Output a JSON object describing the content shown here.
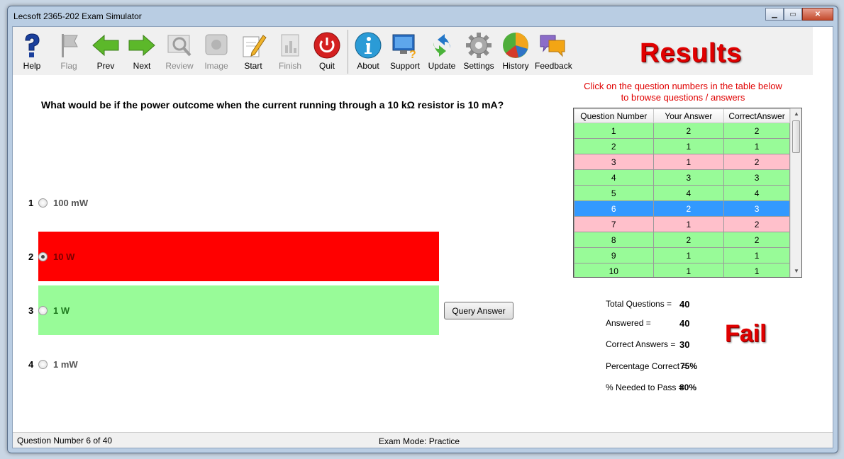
{
  "window": {
    "title": "Lecsoft 2365-202 Exam Simulator",
    "minimize_glyph": "▁",
    "maximize_glyph": "▭",
    "close_glyph": "✕"
  },
  "toolbar": {
    "items": [
      {
        "label": "Help",
        "icon": "help-icon",
        "enabled": true
      },
      {
        "label": "Flag",
        "icon": "flag-icon",
        "enabled": false
      },
      {
        "label": "Prev",
        "icon": "arrow-left-icon",
        "enabled": true
      },
      {
        "label": "Next",
        "icon": "arrow-right-icon",
        "enabled": true
      },
      {
        "label": "Review",
        "icon": "magnifier-icon",
        "enabled": false
      },
      {
        "label": "Image",
        "icon": "image-icon",
        "enabled": false
      },
      {
        "label": "Start",
        "icon": "pencil-paper-icon",
        "enabled": true
      },
      {
        "label": "Finish",
        "icon": "report-icon",
        "enabled": false
      },
      {
        "label": "Quit",
        "icon": "power-icon",
        "enabled": true
      },
      {
        "label": "About",
        "icon": "info-icon",
        "enabled": true
      },
      {
        "label": "Support",
        "icon": "support-monitor-icon",
        "enabled": true
      },
      {
        "label": "Update",
        "icon": "update-arrows-icon",
        "enabled": true
      },
      {
        "label": "Settings",
        "icon": "gear-icon",
        "enabled": true
      },
      {
        "label": "History",
        "icon": "pie-chart-icon",
        "enabled": true
      },
      {
        "label": "Feedback",
        "icon": "speech-bubbles-icon",
        "enabled": true
      }
    ]
  },
  "results": {
    "title": "Results",
    "hint_line1": "Click on the question numbers in the table below",
    "hint_line2": "to browse questions / answers",
    "columns": [
      "Question Number",
      "Your Answer",
      "CorrectAnswer"
    ],
    "rows": [
      {
        "q": "1",
        "yours": "2",
        "correct": "2",
        "status": "ok"
      },
      {
        "q": "2",
        "yours": "1",
        "correct": "1",
        "status": "ok"
      },
      {
        "q": "3",
        "yours": "1",
        "correct": "2",
        "status": "bad"
      },
      {
        "q": "4",
        "yours": "3",
        "correct": "3",
        "status": "ok"
      },
      {
        "q": "5",
        "yours": "4",
        "correct": "4",
        "status": "ok"
      },
      {
        "q": "6",
        "yours": "2",
        "correct": "3",
        "status": "sel"
      },
      {
        "q": "7",
        "yours": "1",
        "correct": "2",
        "status": "bad"
      },
      {
        "q": "8",
        "yours": "2",
        "correct": "2",
        "status": "ok"
      },
      {
        "q": "9",
        "yours": "1",
        "correct": "1",
        "status": "ok"
      },
      {
        "q": "10",
        "yours": "1",
        "correct": "1",
        "status": "ok"
      }
    ]
  },
  "question": {
    "text": "What would be if the power outcome when the current running through a 10 kΩ resistor is 10 mA?",
    "options": [
      {
        "num": "1",
        "text": "100 mW",
        "checked": false
      },
      {
        "num": "2",
        "text": "10 W",
        "checked": true
      },
      {
        "num": "3",
        "text": "1 W",
        "checked": false
      },
      {
        "num": "4",
        "text": "1 mW",
        "checked": false
      }
    ],
    "query_button": "Query Answer"
  },
  "stats": {
    "total_label": "Total Questions =",
    "total_value": "40",
    "answered_label": "Answered =",
    "answered_value": "40",
    "correct_label": "Correct Answers =",
    "correct_value": "30",
    "pct_label": "Percentage Correct =",
    "pct_value": "75%",
    "needed_label": "% Needed to Pass =",
    "needed_value": "80%",
    "verdict": "Fail"
  },
  "status": {
    "question_number": "Question Number 6 of 40",
    "mode": "Exam Mode: Practice"
  },
  "colors": {
    "correct_row": "#98fb98",
    "wrong_row": "#ffc0cb",
    "selected_row": "#3399ff",
    "wrong_answer": "#ff0000",
    "correct_answer": "#98fb98",
    "accent_red": "#e00000"
  }
}
